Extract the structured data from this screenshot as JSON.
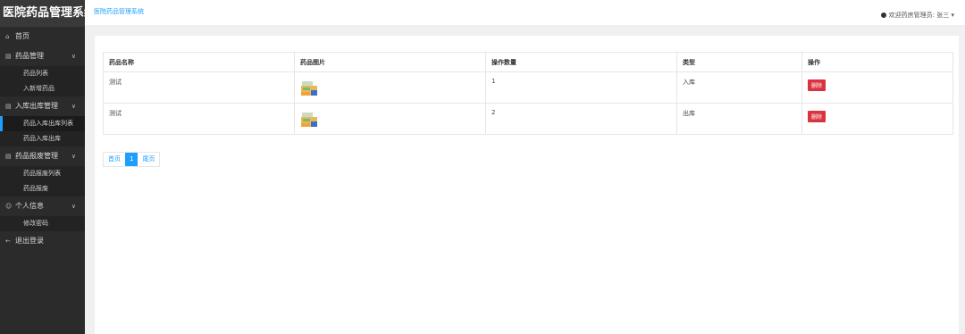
{
  "app": {
    "title": "医院药品管理系统"
  },
  "sidebar": {
    "home": "首页",
    "groups": [
      {
        "label": "药品管理",
        "items": [
          "药品列表",
          "入新增药品"
        ]
      },
      {
        "label": "入库出库管理",
        "items": [
          "药品入库出库列表",
          "药品入库出库"
        ]
      },
      {
        "label": "药品报废管理",
        "items": [
          "药品报废列表",
          "药品报废"
        ]
      },
      {
        "label": "个人信息",
        "items": [
          "修改密码"
        ]
      }
    ],
    "logout": "退出登录"
  },
  "header": {
    "breadcrumb": "医院药品管理系统",
    "user": "欢迎药房管理员: 张三"
  },
  "table": {
    "columns": [
      "药品名称",
      "药品图片",
      "操作数量",
      "类型",
      "操作"
    ],
    "rows": [
      {
        "name": "测试",
        "quantity": "1",
        "type": "入库",
        "action": "删除"
      },
      {
        "name": "测试",
        "quantity": "2",
        "type": "出库",
        "action": "删除"
      }
    ]
  },
  "pager": {
    "first": "首页",
    "current": "1",
    "last": "尾页"
  },
  "colors": {
    "accent": "#1e9fff",
    "danger": "#d9333f",
    "sidebar": "#2b2b2b"
  }
}
